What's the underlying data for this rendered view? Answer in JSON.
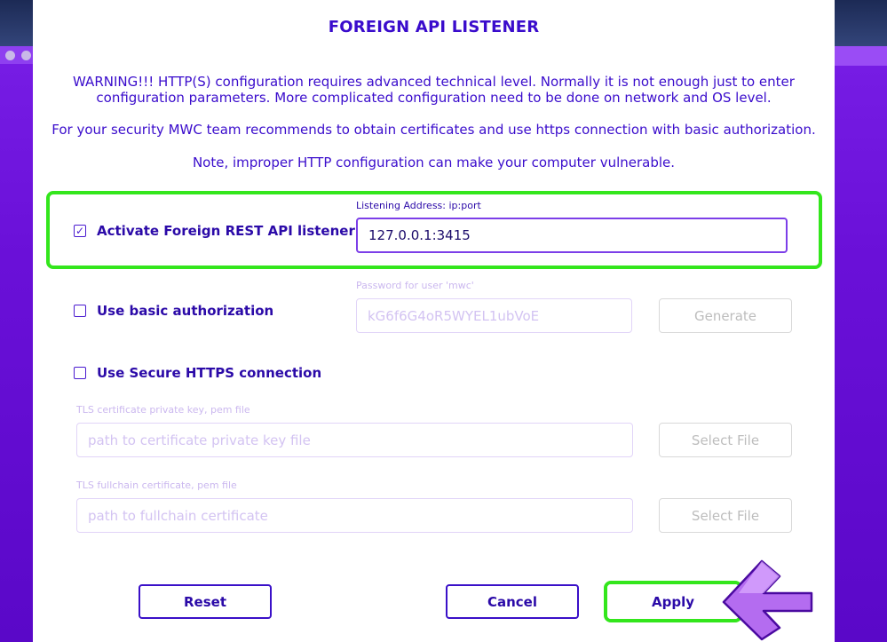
{
  "dialog": {
    "title": "FOREIGN API LISTENER",
    "warning_line1": "WARNING!!!  HTTP(S) configuration requires advanced technical level. Normally it is not enough just to enter",
    "warning_line2": "configuration parameters. More complicated configuration need to be done on network and OS level.",
    "security_note": "For your security MWC team recommends to obtain certificates and use https connection with basic authorization.",
    "vulnerable_note": "Note, improper HTTP configuration can make your computer vulnerable."
  },
  "listener": {
    "checkbox_label": "Activate Foreign REST API listener",
    "checked": true,
    "address_label": "Listening Address: ip:port",
    "address_value": "127.0.0.1:3415"
  },
  "auth": {
    "checkbox_label": "Use basic authorization",
    "checked": false,
    "password_label": "Password for user 'mwc'",
    "password_value": "kG6f6G4oR5WYEL1ubVoE",
    "generate_label": "Generate"
  },
  "https": {
    "checkbox_label": "Use Secure HTTPS connection",
    "checked": false,
    "key_label": "TLS certificate private key, pem file",
    "key_placeholder": "path to certificate private key file",
    "key_select_label": "Select File",
    "chain_label": "TLS fullchain certificate, pem file",
    "chain_placeholder": "path to fullchain certificate",
    "chain_select_label": "Select File"
  },
  "actions": {
    "reset_label": "Reset",
    "cancel_label": "Cancel",
    "apply_label": "Apply"
  },
  "colors": {
    "accent": "#3a0ccc",
    "highlight": "#33e61c",
    "background": "#6a10d8"
  }
}
